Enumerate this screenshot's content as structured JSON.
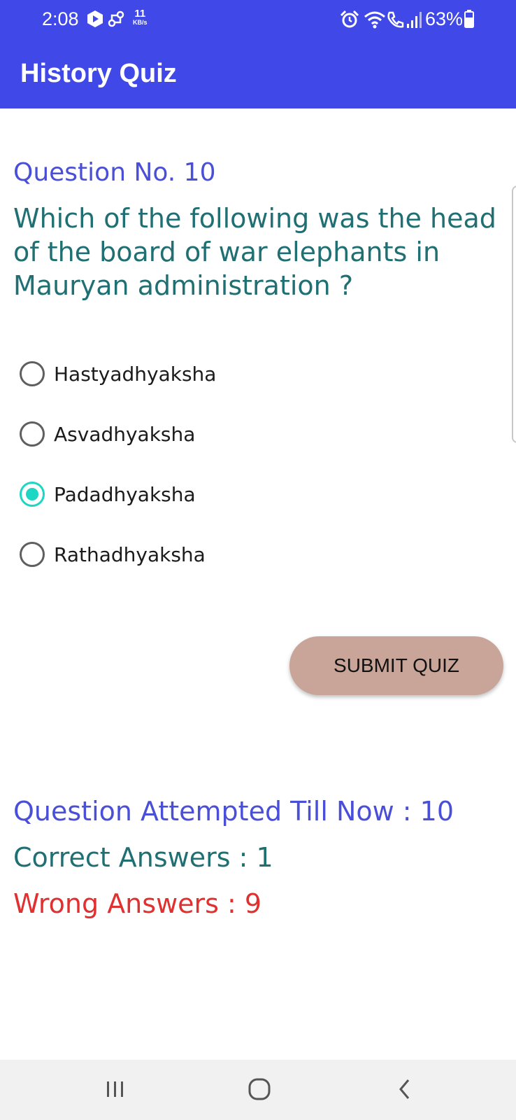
{
  "status_bar": {
    "time": "2:08",
    "net_speed_value": "11",
    "net_speed_unit": "KB/s",
    "battery": "63%",
    "icons": [
      "play-icon",
      "link-icon",
      "alarm-icon",
      "wifi-icon",
      "wifi-call-icon",
      "signal-icon",
      "battery-icon"
    ]
  },
  "app_bar": {
    "title": "History Quiz",
    "background": "#4049e8"
  },
  "question": {
    "number_label": "Question No. 10",
    "text": "Which of the following was the head of the board of war elephants in Mauryan administration ?"
  },
  "options": [
    {
      "label": "Hastyadhyaksha",
      "selected": false
    },
    {
      "label": "Asvadhyaksha",
      "selected": false
    },
    {
      "label": "Padadhyaksha",
      "selected": true
    },
    {
      "label": "Rathadhyaksha",
      "selected": false
    }
  ],
  "submit_button": {
    "label": "SUBMIT QUIZ",
    "color": "#c8a598"
  },
  "stats": {
    "attempted": "Question Attempted Till Now : 10",
    "correct": "Correct Answers : 1",
    "wrong": "Wrong Answers : 9"
  },
  "colors": {
    "accent": "#4a4fd8",
    "question": "#1f6f73",
    "wrong": "#e03030",
    "radio_selected": "#1dd6c4"
  },
  "nav_bar": {
    "icons": [
      "recent-apps-icon",
      "home-icon",
      "back-icon"
    ]
  }
}
